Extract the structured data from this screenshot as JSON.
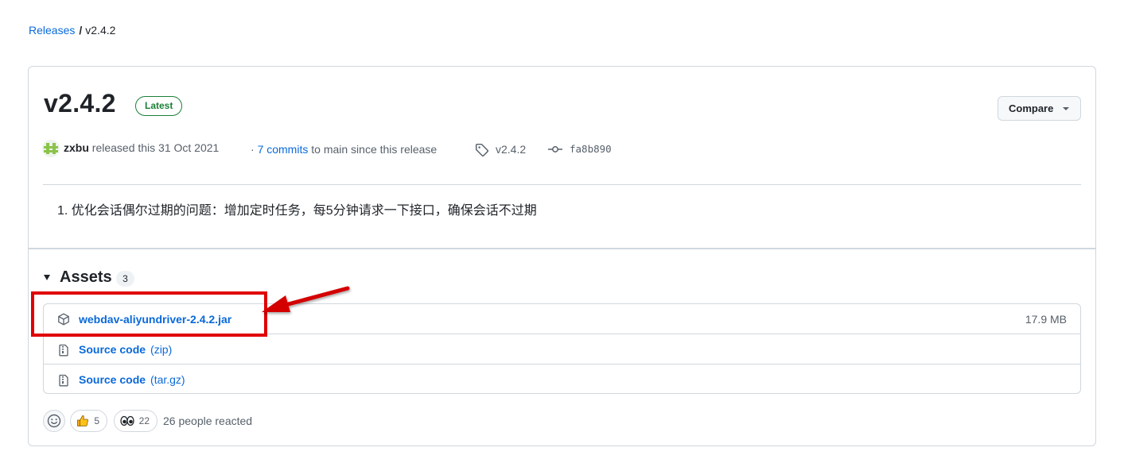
{
  "breadcrumb": {
    "parent": "Releases",
    "separator": "/",
    "current": "v2.4.2"
  },
  "release": {
    "title": "v2.4.2",
    "badge": "Latest",
    "compare_label": "Compare",
    "author": "zxbu",
    "released_text": "released this 31 Oct 2021",
    "commits_prefix": "·",
    "commits_link": "7 commits",
    "commits_suffix": "to main since this release",
    "tag": "v2.4.2",
    "commit_sha": "fa8b890",
    "notes": [
      "1. 优化会话偶尔过期的问题：增加定时任务，每5分钟请求一下接口，确保会话不过期"
    ]
  },
  "assets": {
    "title": "Assets",
    "count": "3",
    "items": [
      {
        "name": "webdav-aliyundriver-2.4.2.jar",
        "format": "",
        "size": "17.9 MB",
        "icon": "package-icon"
      },
      {
        "name": "Source code",
        "format": "(zip)",
        "size": "",
        "icon": "file-zip-icon"
      },
      {
        "name": "Source code",
        "format": "(tar.gz)",
        "size": "",
        "icon": "file-zip-icon"
      }
    ]
  },
  "reactions": {
    "items": [
      {
        "emoji": "thumbs-up",
        "count": "5"
      },
      {
        "emoji": "eyes",
        "count": "22"
      }
    ],
    "summary": "26 people reacted"
  },
  "colors": {
    "link": "#0969da",
    "latest_badge": "#1a7f37",
    "annotation": "#e00000"
  }
}
